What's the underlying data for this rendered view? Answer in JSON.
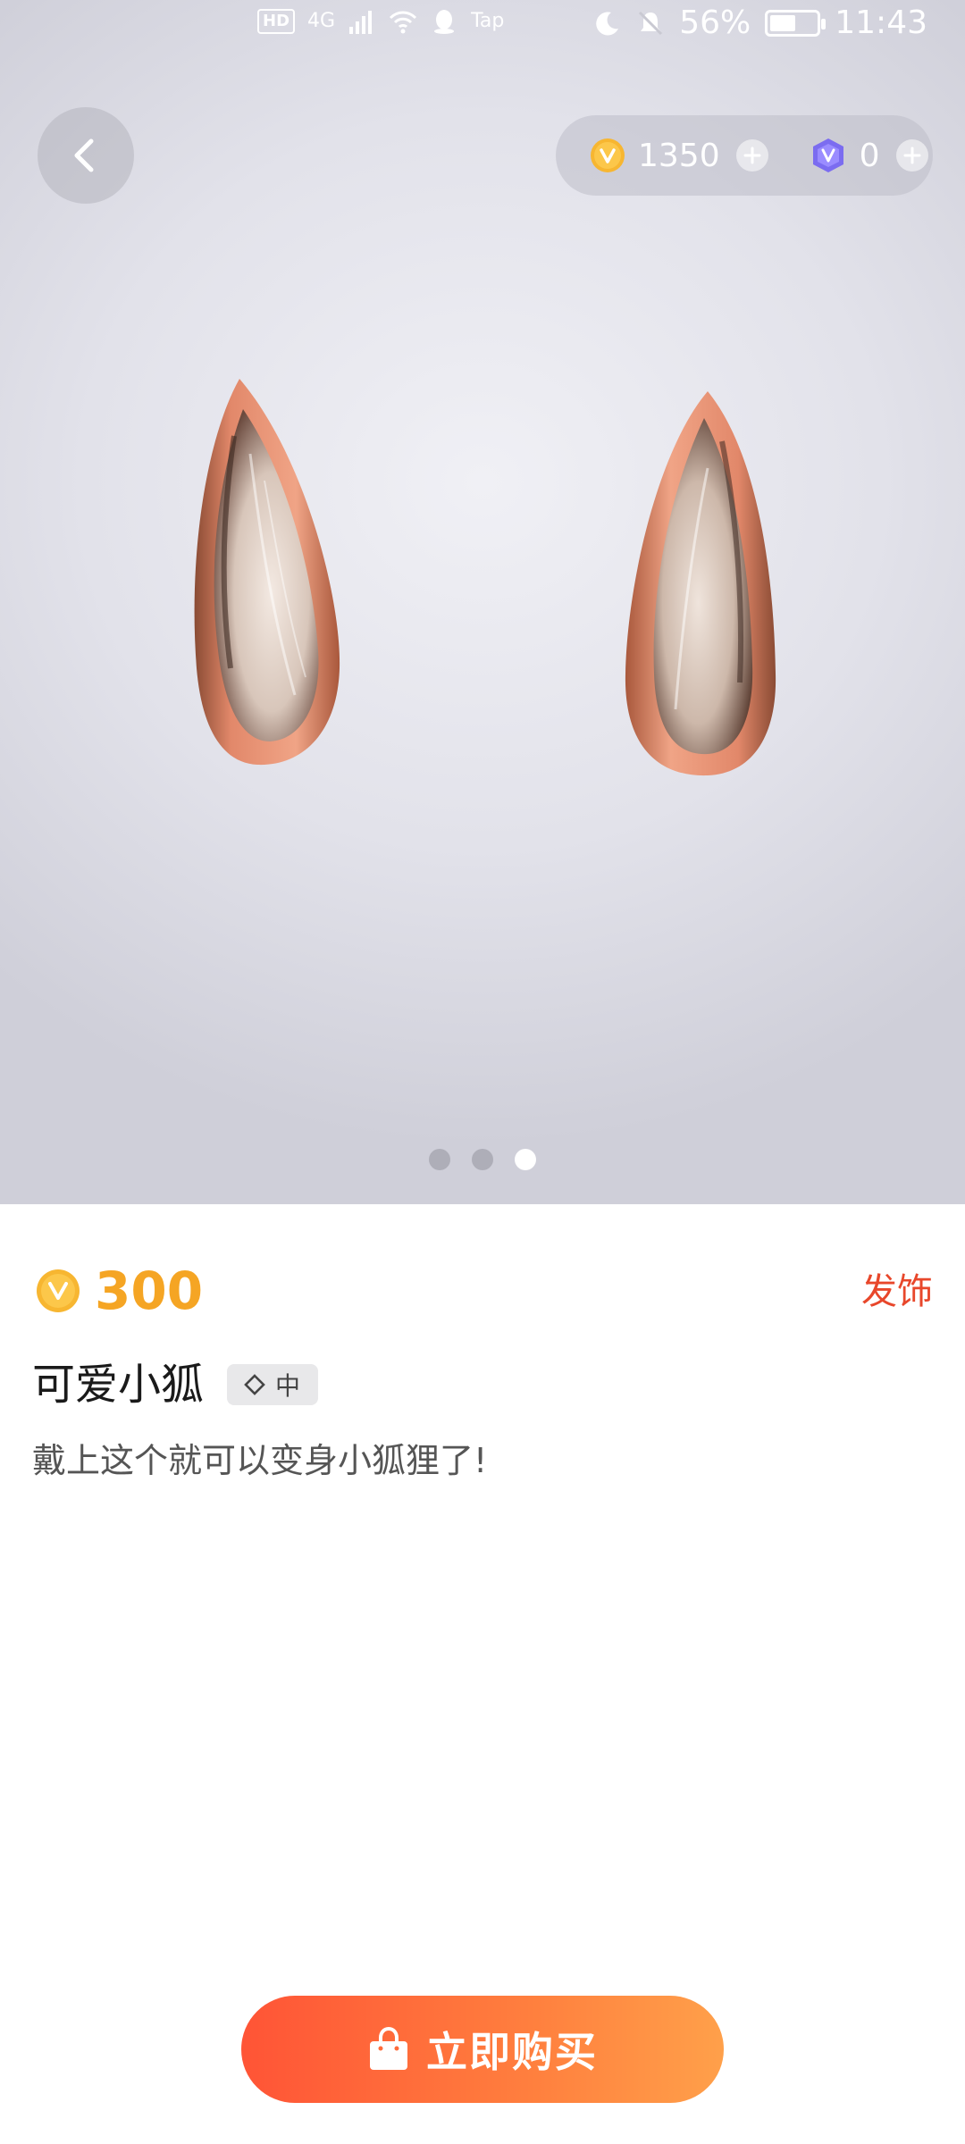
{
  "status_bar": {
    "hd_label": "HD",
    "network_label": "4G",
    "app_label": "Tap",
    "battery_text": "56%",
    "battery_level": 0.56,
    "time": "11:43"
  },
  "header": {
    "back_icon": "chevron-left-icon",
    "coins": {
      "icon": "v-coin-icon",
      "value": "1350",
      "add_icon": "plus-icon"
    },
    "gems": {
      "icon": "v-gem-icon",
      "value": "0",
      "add_icon": "plus-icon"
    }
  },
  "preview": {
    "image": "fox-ears-3d-model",
    "pagination": {
      "count": 3,
      "active_index": 2
    }
  },
  "item": {
    "price_icon": "v-coin-icon",
    "price": "300",
    "category": "发饰",
    "name": "可爱小狐",
    "tag_icon": "diamond-outline-icon",
    "tag_label": "中",
    "description": "戴上这个就可以变身小狐狸了!"
  },
  "buy_button": {
    "icon": "shopping-bag-icon",
    "label": "立即购买"
  },
  "colors": {
    "price": "#f5a524",
    "category": "#e8472b",
    "button_start": "#ff5436",
    "button_end": "#ffa04a"
  }
}
